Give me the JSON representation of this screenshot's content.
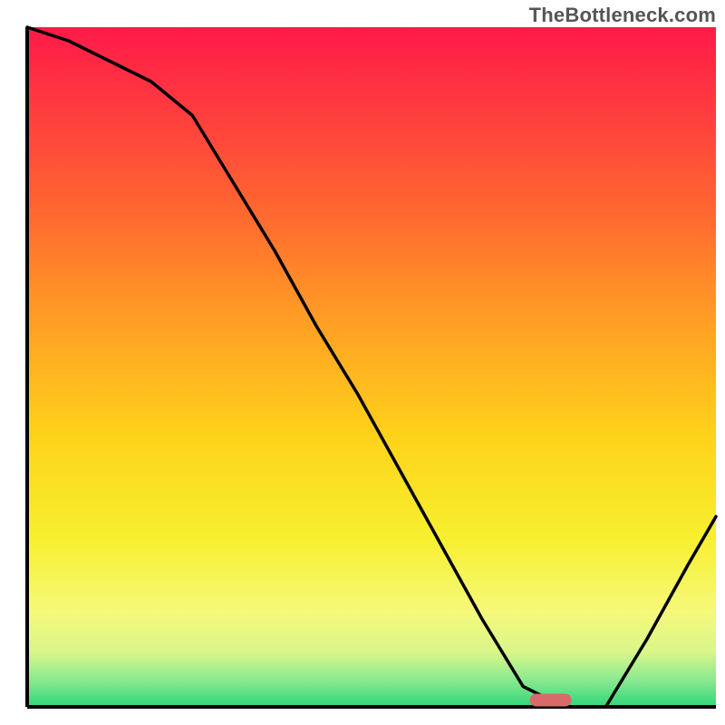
{
  "watermark": "TheBottleneck.com",
  "chart_data": {
    "type": "line",
    "title": "",
    "xlabel": "",
    "ylabel": "",
    "xlim": [
      0,
      100
    ],
    "ylim": [
      0,
      100
    ],
    "grid": false,
    "legend": false,
    "x": [
      0,
      6,
      12,
      18,
      24,
      30,
      36,
      42,
      48,
      54,
      60,
      66,
      72,
      78,
      84,
      90,
      96,
      100
    ],
    "values": [
      100,
      98,
      95,
      92,
      87,
      77,
      67,
      56,
      46,
      35,
      24,
      13,
      3,
      0,
      0,
      10,
      21,
      28
    ],
    "marker": {
      "x": 76,
      "y": 1,
      "color": "#d86a6a"
    },
    "gradient_stops": [
      {
        "offset": 0.0,
        "color": "#ff1a49"
      },
      {
        "offset": 0.12,
        "color": "#ff3b3f"
      },
      {
        "offset": 0.28,
        "color": "#ff6a2f"
      },
      {
        "offset": 0.45,
        "color": "#ffa423"
      },
      {
        "offset": 0.6,
        "color": "#ffd21a"
      },
      {
        "offset": 0.75,
        "color": "#f7ef2e"
      },
      {
        "offset": 0.86,
        "color": "#f6f97a"
      },
      {
        "offset": 0.92,
        "color": "#d8f68a"
      },
      {
        "offset": 0.96,
        "color": "#8ce98f"
      },
      {
        "offset": 1.0,
        "color": "#2fd67a"
      }
    ],
    "axis_color": "#000000",
    "curve_color": "#000000"
  }
}
